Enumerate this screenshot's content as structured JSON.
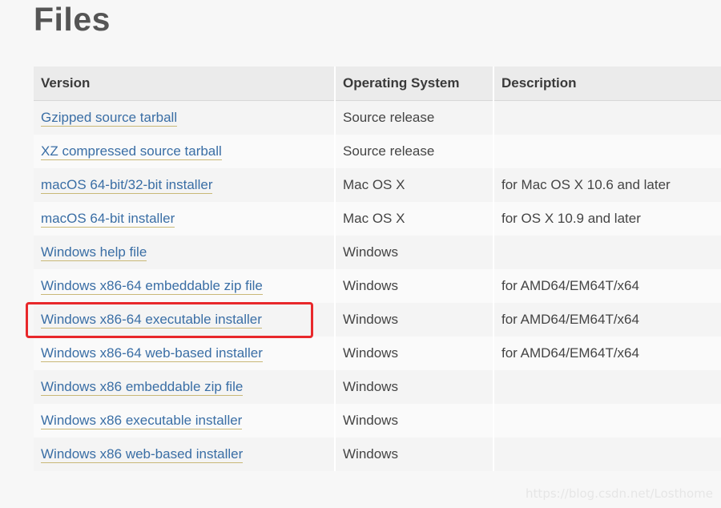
{
  "page": {
    "title": "Files"
  },
  "table": {
    "headers": [
      "Version",
      "Operating System",
      "Description"
    ],
    "rows": [
      {
        "version": "Gzipped source tarball",
        "os": "Source release",
        "description": ""
      },
      {
        "version": "XZ compressed source tarball",
        "os": "Source release",
        "description": ""
      },
      {
        "version": "macOS 64-bit/32-bit installer",
        "os": "Mac OS X",
        "description": "for Mac OS X 10.6 and later"
      },
      {
        "version": "macOS 64-bit installer",
        "os": "Mac OS X",
        "description": "for OS X 10.9 and later"
      },
      {
        "version": "Windows help file",
        "os": "Windows",
        "description": ""
      },
      {
        "version": "Windows x86-64 embeddable zip file",
        "os": "Windows",
        "description": "for AMD64/EM64T/x64"
      },
      {
        "version": "Windows x86-64 executable installer",
        "os": "Windows",
        "description": "for AMD64/EM64T/x64"
      },
      {
        "version": "Windows x86-64 web-based installer",
        "os": "Windows",
        "description": "for AMD64/EM64T/x64"
      },
      {
        "version": "Windows x86 embeddable zip file",
        "os": "Windows",
        "description": ""
      },
      {
        "version": "Windows x86 executable installer",
        "os": "Windows",
        "description": ""
      },
      {
        "version": "Windows x86 web-based installer",
        "os": "Windows",
        "description": ""
      }
    ]
  },
  "annotation": {
    "highlighted_row": "Windows x86-64 executable installer",
    "color": "#e8282b"
  },
  "watermark": {
    "text": "https://blog.csdn.net/Losthome"
  },
  "colors": {
    "link": "#3a6ea5",
    "link_underline": "#c9b877",
    "background": "#f7f7f7"
  }
}
